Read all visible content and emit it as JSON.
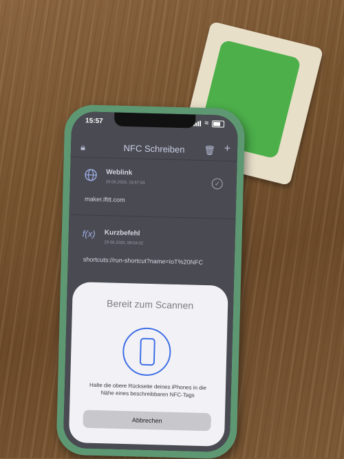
{
  "status_bar": {
    "time": "15:57"
  },
  "nav": {
    "title": "NFC Schreiben"
  },
  "records": [
    {
      "title": "Weblink",
      "date": "29.06.2020, 15:57:04",
      "content": "maker.ifttt.com"
    },
    {
      "title": "Kurzbefehl",
      "date": "29.06.2020, 08:04:02",
      "content": "shortcuts://run-shortcut?name=IoT%20NFC"
    }
  ],
  "scan_sheet": {
    "title": "Bereit zum Scannen",
    "instruction": "Halte die obere Rückseite deines iPhones in die Nähe eines beschreibbaren NFC-Tags",
    "cancel_label": "Abbrechen"
  },
  "colors": {
    "accent": "#3d6ee6",
    "sticker": "#4caf4a",
    "phone_case": "#5e9873"
  }
}
